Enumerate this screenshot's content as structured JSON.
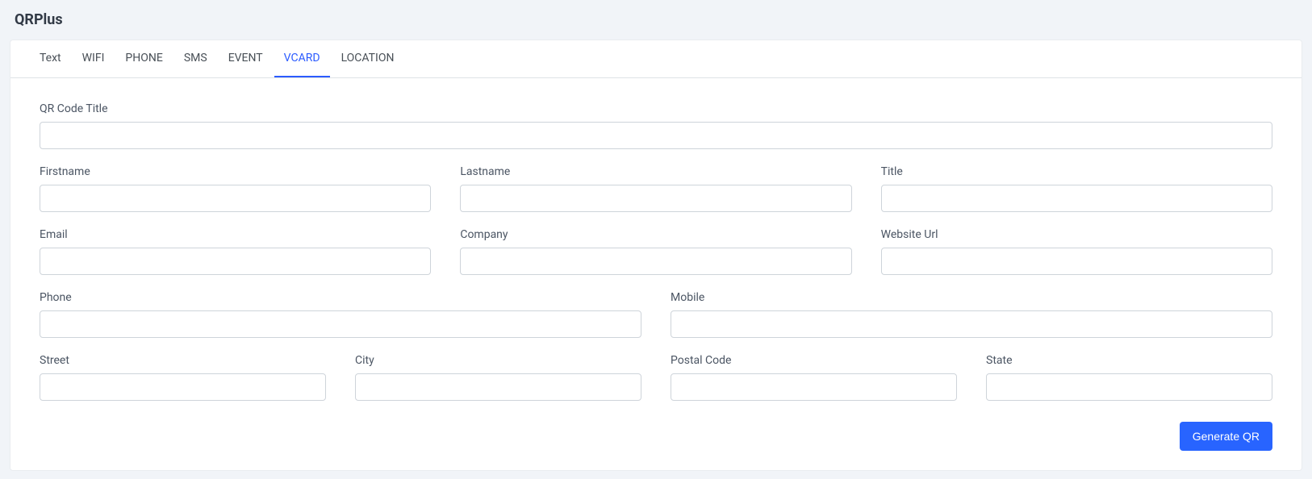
{
  "app_title": "QRPlus",
  "tabs": [
    {
      "label": "Text",
      "active": false
    },
    {
      "label": "WIFI",
      "active": false
    },
    {
      "label": "PHONE",
      "active": false
    },
    {
      "label": "SMS",
      "active": false
    },
    {
      "label": "EVENT",
      "active": false
    },
    {
      "label": "VCARD",
      "active": true
    },
    {
      "label": "LOCATION",
      "active": false
    }
  ],
  "form": {
    "qr_title_label": "QR Code Title",
    "qr_title_value": "",
    "firstname_label": "Firstname",
    "firstname_value": "",
    "lastname_label": "Lastname",
    "lastname_value": "",
    "title_label": "Title",
    "title_value": "",
    "email_label": "Email",
    "email_value": "",
    "company_label": "Company",
    "company_value": "",
    "website_label": "Website Url",
    "website_value": "",
    "phone_label": "Phone",
    "phone_value": "",
    "mobile_label": "Mobile",
    "mobile_value": "",
    "street_label": "Street",
    "street_value": "",
    "city_label": "City",
    "city_value": "",
    "postal_label": "Postal Code",
    "postal_value": "",
    "state_label": "State",
    "state_value": ""
  },
  "actions": {
    "generate_label": "Generate QR"
  }
}
